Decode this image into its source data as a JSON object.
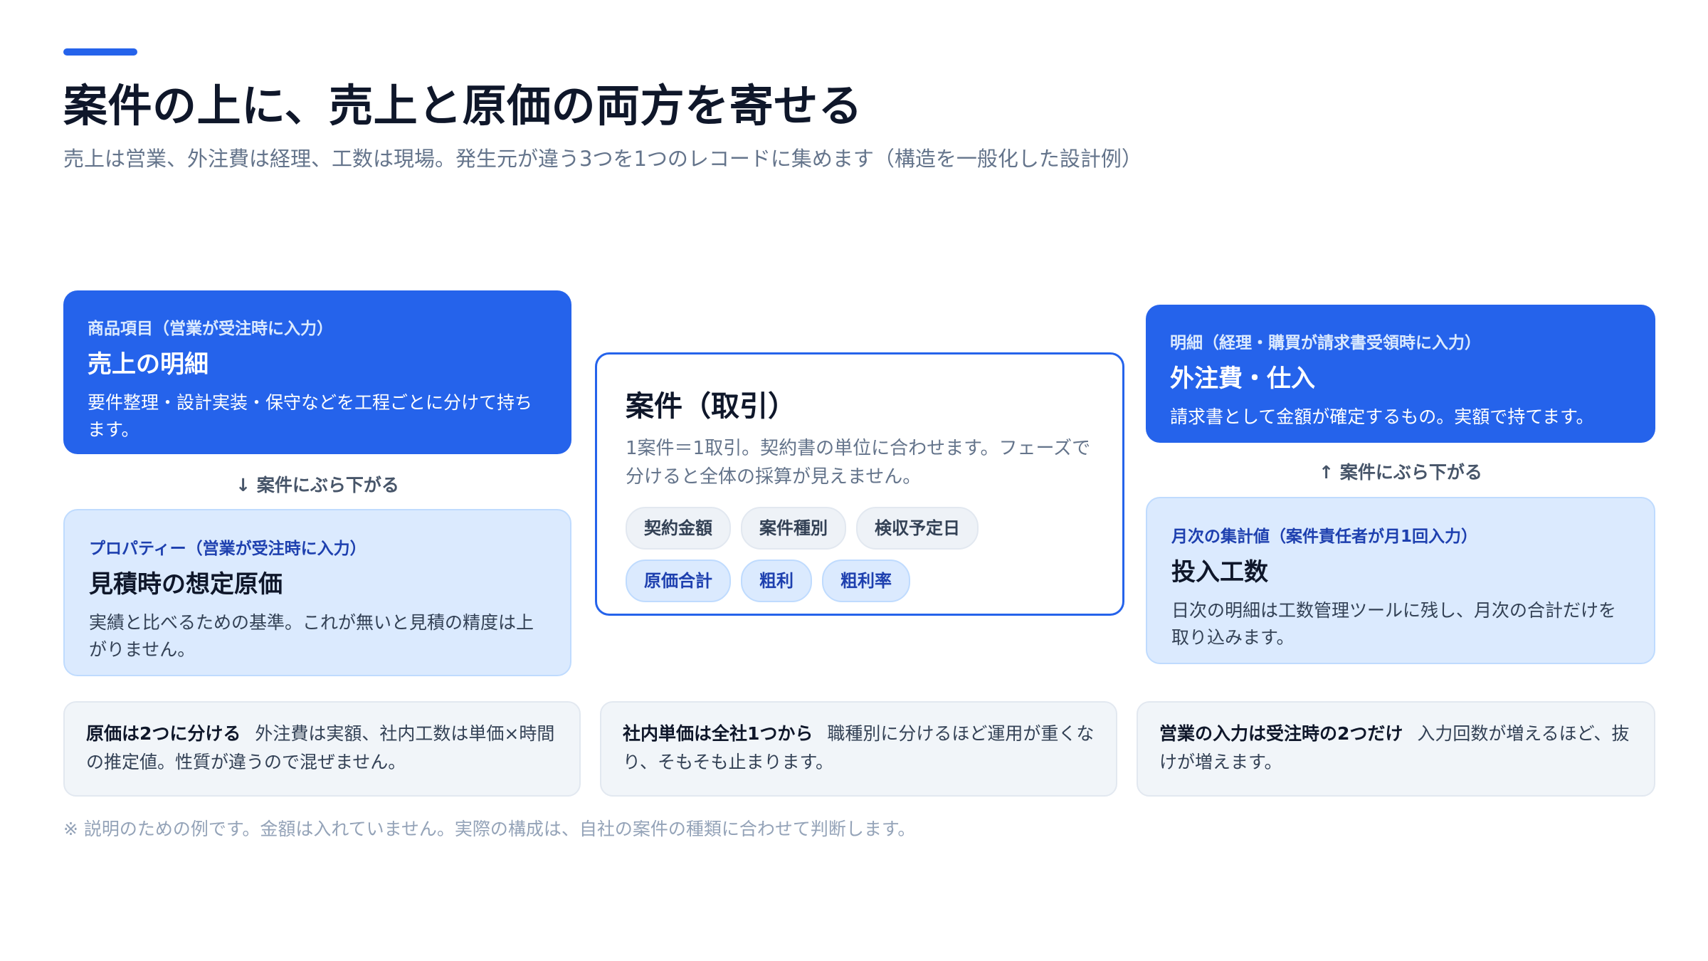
{
  "header": {
    "title": "案件の上に、売上と原価の両方を寄せる",
    "subtitle": "売上は営業、外注費は経理、工数は現場。発生元が違う3つを1つのレコードに集めます（構造を一般化した設計例）"
  },
  "left": {
    "sales_card": {
      "kicker": "商品項目（営業が受注時に入力）",
      "title": "売上の明細",
      "description": "要件整理・設計実装・保守などを工程ごとに分けて持ちます。"
    },
    "connector": "↓ 案件にぶら下がる",
    "estimate_card": {
      "kicker": "プロパティー（営業が受注時に入力）",
      "title": "見積時の想定原価",
      "description": "実績と比べるための基準。これが無いと見積の精度は上がりません。"
    }
  },
  "center": {
    "deal_card": {
      "title": "案件（取引）",
      "description": "1案件＝1取引。契約書の単位に合わせます。フェーズで分けると全体の採算が見えません。",
      "fields_gray": [
        "契約金額",
        "案件種別",
        "検収予定日"
      ],
      "fields_blue": [
        "原価合計",
        "粗利",
        "粗利率"
      ]
    }
  },
  "right": {
    "outsourcing_card": {
      "kicker": "明細（経理・購買が請求書受領時に入力）",
      "title": "外注費・仕入",
      "description": "請求書として金額が確定するもの。実額で持てます。"
    },
    "connector": "↑ 案件にぶら下がる",
    "hours_card": {
      "kicker": "月次の集計値（案件責任者が月1回入力）",
      "title": "投入工数",
      "description": "日次の明細は工数管理ツールに残し、月次の合計だけを取り込みます。"
    }
  },
  "notes": [
    {
      "strong": "原価は2つに分ける",
      "text": "外注費は実額、社内工数は単価×時間の推定値。性質が違うので混ぜません。"
    },
    {
      "strong": "社内単価は全社1つから",
      "text": "職種別に分けるほど運用が重くなり、そもそも止まります。"
    },
    {
      "strong": "営業の入力は受注時の2つだけ",
      "text": "入力回数が増えるほど、抜けが増えます。"
    }
  ],
  "footnote": "※ 説明のための例です。金額は入れていません。実際の構成は、自社の案件の種類に合わせて判断します。",
  "colors": {
    "accent": "#2563eb",
    "light_card": "#dbeafe",
    "note_background": "#f1f5f9",
    "title_text": "#0f172a",
    "muted_text": "#64748b"
  }
}
